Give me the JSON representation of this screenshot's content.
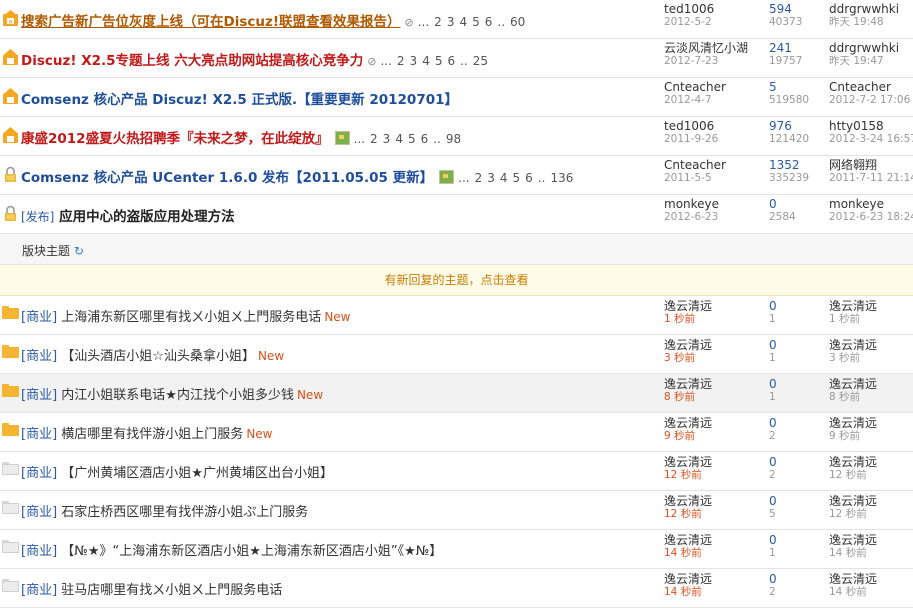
{
  "sticky": [
    {
      "title": "搜索广告新广告位灰度上线（可在Discuz!联盟查看效果报告）",
      "color": "#b05a00",
      "underline": true,
      "clip": "⊘",
      "pages": [
        "...",
        "2",
        "3",
        "4",
        "5",
        "6",
        "..",
        "60"
      ],
      "img": false,
      "author": "ted1006",
      "date": "2012-5-2",
      "replies": "594",
      "views": "40373",
      "last": "ddrgrwwhki",
      "lastdate": "昨天 19:48",
      "icon": "announce"
    },
    {
      "title": "Discuz! X2.5专题上线 六大亮点助网站提高核心竞争力",
      "color": "#c21a1a",
      "underline": false,
      "clip": "⊘",
      "pages": [
        "...",
        "2",
        "3",
        "4",
        "5",
        "6",
        "..",
        "25"
      ],
      "img": false,
      "author": "云淡风清忆小湖",
      "date": "2012-7-23",
      "replies": "241",
      "views": "19757",
      "last": "ddrgrwwhki",
      "lastdate": "昨天 19:47",
      "icon": "up"
    },
    {
      "title": "Comsenz 核心产品 Discuz! X2.5 正式版.【重要更新 20120701】",
      "color": "#1f4f9c",
      "underline": false,
      "clip": "",
      "pages": [],
      "img": false,
      "author": "Cnteacher",
      "date": "2012-4-7",
      "replies": "5",
      "views": "519580",
      "last": "Cnteacher",
      "lastdate": "2012-7-2 17:06",
      "icon": "up"
    },
    {
      "title": "康盛2012盛夏火热招聘季『未来之梦，在此绽放』",
      "color": "#c21a1a",
      "underline": false,
      "clip": "",
      "pages": [
        "...",
        "2",
        "3",
        "4",
        "5",
        "6",
        "..",
        "98"
      ],
      "img": true,
      "author": "ted1006",
      "date": "2011-9-26",
      "replies": "976",
      "views": "121420",
      "last": "htty0158",
      "lastdate": "2012-3-24 16:57",
      "icon": "up"
    },
    {
      "title": "Comsenz 核心产品 UCenter 1.6.0 发布【2011.05.05 更新】",
      "color": "#1f4f9c",
      "underline": false,
      "clip": "",
      "pages": [
        "...",
        "2",
        "3",
        "4",
        "5",
        "6",
        "..",
        "136"
      ],
      "img": true,
      "author": "Cnteacher",
      "date": "2011-5-5",
      "replies": "1352",
      "views": "335239",
      "last": "网络翱翔",
      "lastdate": "2011-7-11 21:14",
      "icon": "lock"
    },
    {
      "title": "应用中心的盗版应用处理方法",
      "prefix": "[发布]",
      "color": "#222222",
      "underline": false,
      "clip": "",
      "pages": [],
      "img": false,
      "author": "monkeye",
      "date": "2012-6-23",
      "replies": "0",
      "views": "2584",
      "last": "monkeye",
      "lastdate": "2012-6-23 18:24",
      "icon": "lock"
    }
  ],
  "section_label": "版块主题",
  "refresh_icon": "refresh-icon",
  "notice": "有新回复的主题，点击查看",
  "threads": [
    {
      "tag": "[商业]",
      "title": "上海浦东新区哪里有找ㄨ小姐ㄨ上門服务电话",
      "new": "New",
      "author": "逸云清远",
      "time": "1 秒前",
      "replies": "0",
      "views": "1",
      "last": "逸云清远",
      "lasttime": "1 秒前",
      "folder": "yellow",
      "hl": false
    },
    {
      "tag": "[商业]",
      "title": "【汕头酒店小姐☆汕头桑拿小姐】",
      "new": "New",
      "author": "逸云清远",
      "time": "3 秒前",
      "replies": "0",
      "views": "1",
      "last": "逸云清远",
      "lasttime": "3 秒前",
      "folder": "yellow",
      "hl": false
    },
    {
      "tag": "[商业]",
      "title": "内江小姐联系电话★内江找个小姐多少钱",
      "new": "New",
      "author": "逸云清远",
      "time": "8 秒前",
      "replies": "0",
      "views": "1",
      "last": "逸云清远",
      "lasttime": "8 秒前",
      "folder": "yellow",
      "hl": true
    },
    {
      "tag": "[商业]",
      "title": "横店哪里有找伴游小姐上门服务",
      "new": "New",
      "author": "逸云清远",
      "time": "9 秒前",
      "replies": "0",
      "views": "2",
      "last": "逸云清远",
      "lasttime": "9 秒前",
      "folder": "yellow",
      "hl": false
    },
    {
      "tag": "[商业]",
      "title": "【广州黄埔区酒店小姐★广州黄埔区出台小姐】",
      "new": "",
      "author": "逸云清远",
      "time": "12 秒前",
      "replies": "0",
      "views": "2",
      "last": "逸云清远",
      "lasttime": "12 秒前",
      "folder": "gray",
      "hl": false
    },
    {
      "tag": "[商业]",
      "title": "石家庄桥西区哪里有找伴游小姐ぷ上门服务",
      "new": "",
      "author": "逸云清远",
      "time": "12 秒前",
      "replies": "0",
      "views": "5",
      "last": "逸云清远",
      "lasttime": "12 秒前",
      "folder": "gray",
      "hl": false
    },
    {
      "tag": "[商业]",
      "title": "【№★》“上海浦东新区酒店小姐★上海浦东新区酒店小姐”《★№】",
      "new": "",
      "author": "逸云清远",
      "time": "14 秒前",
      "replies": "0",
      "views": "1",
      "last": "逸云清远",
      "lasttime": "14 秒前",
      "folder": "gray",
      "hl": false
    },
    {
      "tag": "[商业]",
      "title": "驻马店哪里有找ㄨ小姐ㄨ上門服务电话",
      "new": "",
      "author": "逸云清远",
      "time": "14 秒前",
      "replies": "0",
      "views": "2",
      "last": "逸云清远",
      "lasttime": "14 秒前",
      "folder": "gray",
      "hl": false
    }
  ]
}
